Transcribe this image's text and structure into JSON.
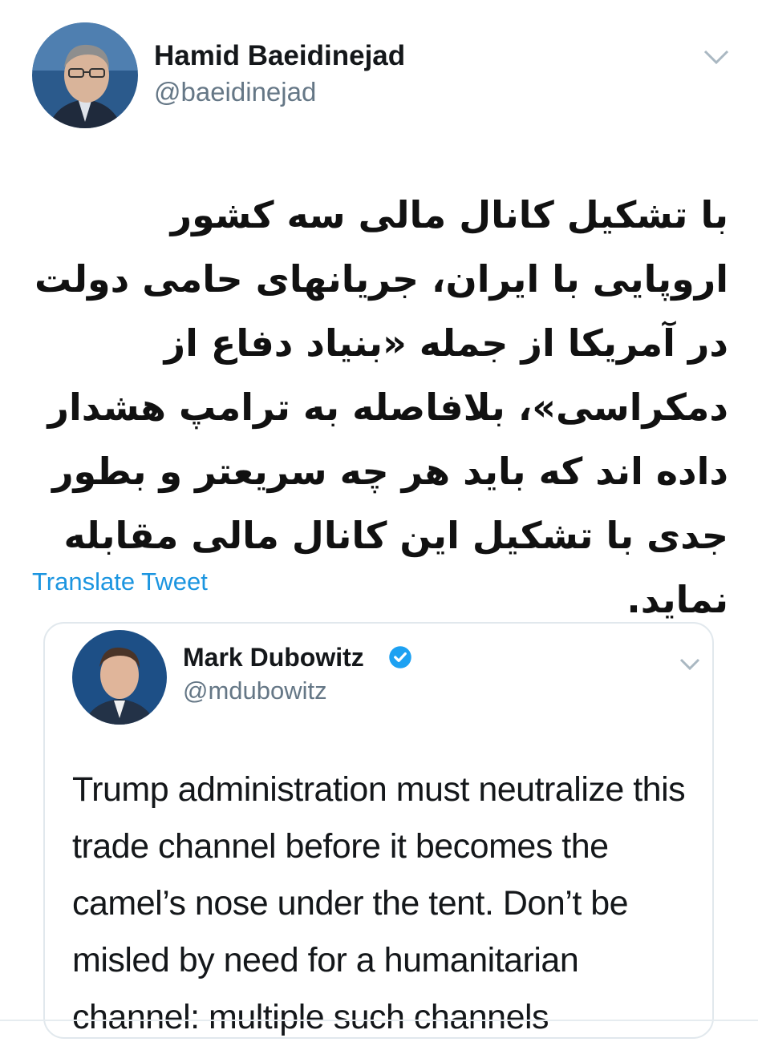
{
  "tweet": {
    "author_name": "Hamid Baeidinejad",
    "author_handle": "@baeidinejad",
    "menu_icon": "chevron-down-icon",
    "text": "با تشکیل کانال مالی سه کشور اروپایی با ایران، جریانهای حامی دولت در آمریکا از جمله «بنیاد دفاع از دمکراسی»، بلافاصله به ترامپ هشدار داده اند که باید هر چه سریعتر و بطور جدی با تشکیل این کانال مالی مقابله نماید.",
    "translate_label": "Translate Tweet"
  },
  "quoted_tweet": {
    "author_name": "Mark Dubowitz",
    "author_handle": "@mdubowitz",
    "verified_icon": "verified-badge-icon",
    "menu_icon": "chevron-down-icon",
    "text": "Trump administration must neutralize this trade channel before it becomes the camel’s nose under the tent. Don’t be misled by need for a humanitarian channel: multiple such channels"
  },
  "colors": {
    "link": "#1b95e0",
    "handle": "#657786",
    "border": "#e1e8ed",
    "verified": "#1da1f2"
  }
}
